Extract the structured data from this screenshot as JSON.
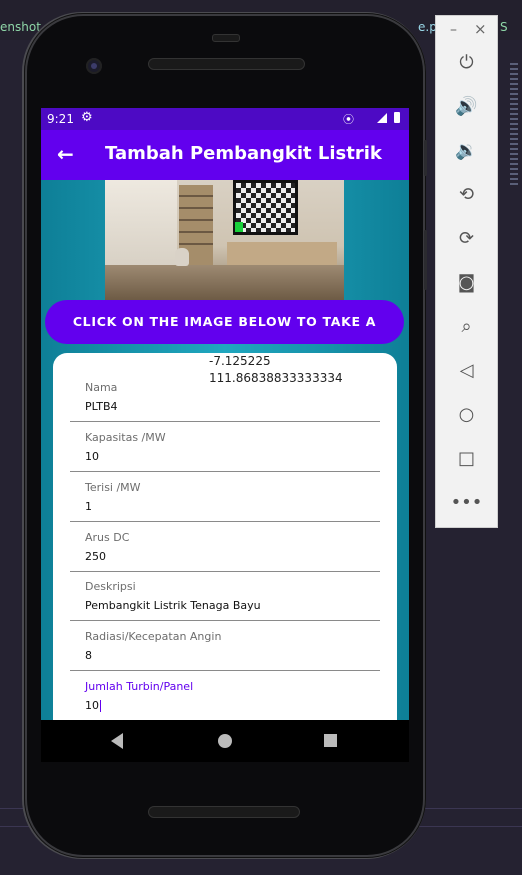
{
  "background": {
    "tab_left": "enshot",
    "tab_right": "e.pn",
    "tab_right2": "S"
  },
  "status_bar": {
    "time": "9:21"
  },
  "app_bar": {
    "back_icon": "arrow-left-icon",
    "title": "Tambah Pembangkit Listrik"
  },
  "photo_button": {
    "label": "CLICK ON THE IMAGE BELOW TO TAKE A PHOTO"
  },
  "coordinates": {
    "latitude": "-7.125225",
    "longitude": "111.86838833333334"
  },
  "form": {
    "fields": [
      {
        "label": "Nama",
        "value": "PLTB4"
      },
      {
        "label": "Kapasitas /MW",
        "value": "10"
      },
      {
        "label": "Terisi /MW",
        "value": "1"
      },
      {
        "label": "Arus DC",
        "value": "250"
      },
      {
        "label": "Deskripsi",
        "value": "Pembangkit Listrik Tenaga Bayu"
      },
      {
        "label": "Radiasi/Kecepatan Angin",
        "value": "8"
      },
      {
        "label": "Jumlah Turbin/Panel",
        "value": "10"
      }
    ]
  },
  "emulator_toolbar": {
    "minimize": "–",
    "close": "×",
    "icons": [
      "power-icon",
      "volume-up-icon",
      "volume-down-icon",
      "rotate-left-icon",
      "rotate-right-icon",
      "camera-icon",
      "zoom-icon",
      "back-icon",
      "home-icon",
      "overview-icon",
      "more-icon"
    ]
  },
  "colors": {
    "primary": "#6200ee",
    "status_bar": "#4d0ac4",
    "background": "#1ea0b8"
  }
}
